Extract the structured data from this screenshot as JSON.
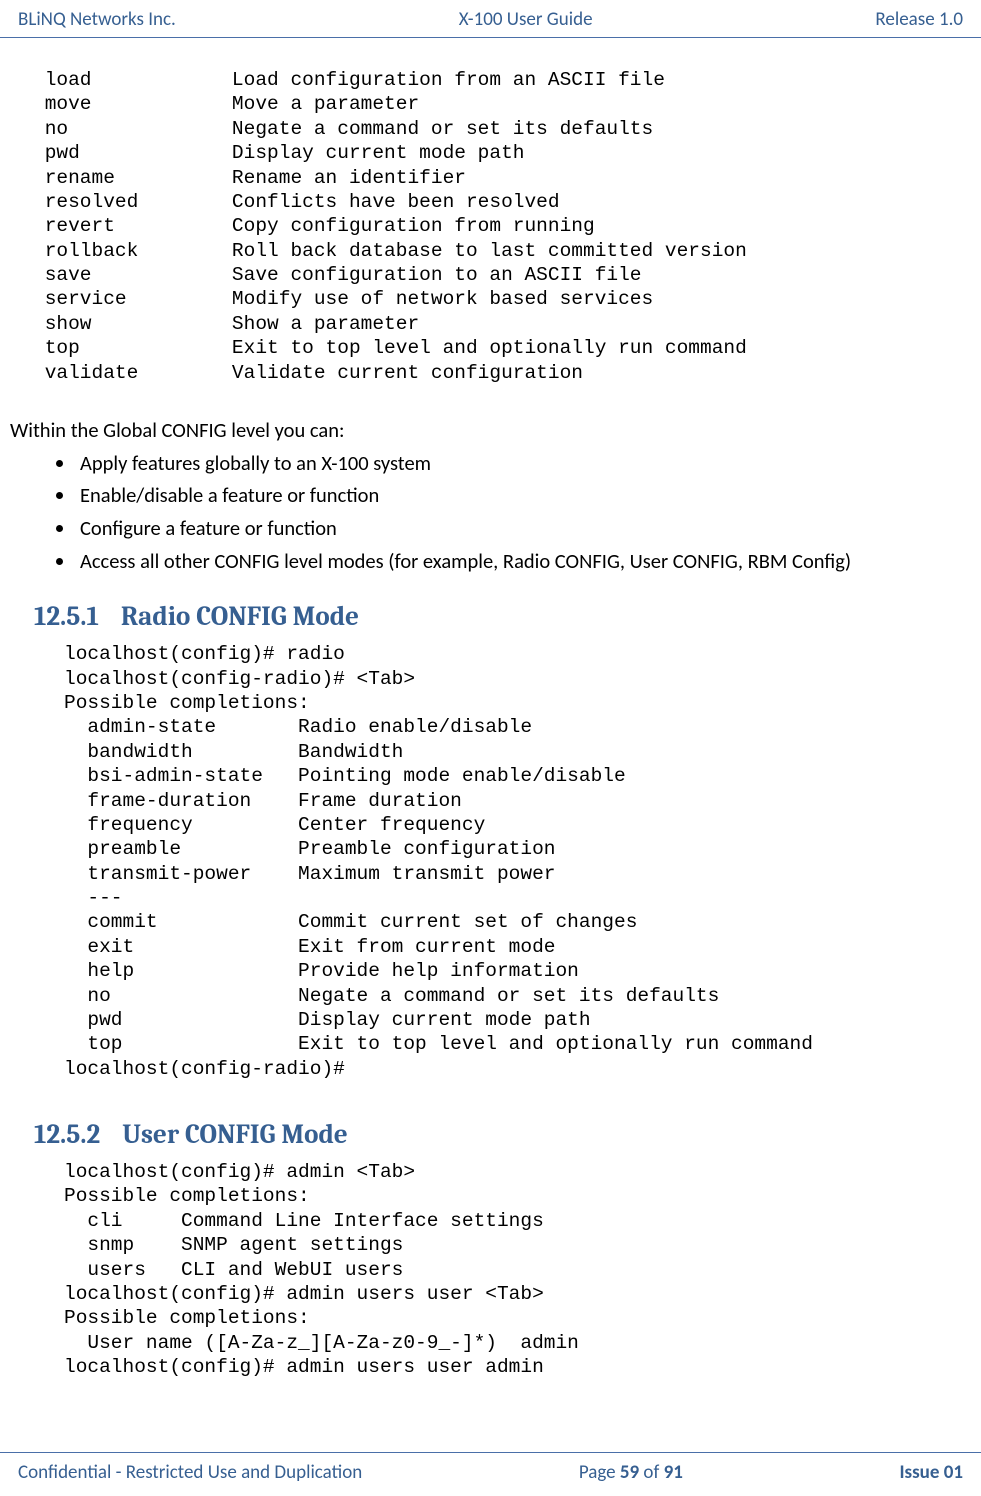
{
  "header": {
    "left": "BLiNQ Networks Inc.",
    "center": "X-100 User Guide",
    "right": "Release 1.0"
  },
  "footer": {
    "left": "Confidential - Restricted Use and Duplication",
    "center_prefix": "Page ",
    "center_page": "59",
    "center_of": " of ",
    "center_total": "91",
    "right": "Issue 01"
  },
  "block1": " load            Load configuration from an ASCII file\n move            Move a parameter\n no              Negate a command or set its defaults\n pwd             Display current mode path\n rename          Rename an identifier\n resolved        Conflicts have been resolved\n revert          Copy configuration from running\n rollback        Roll back database to last committed version\n save            Save configuration to an ASCII file\n service         Modify use of network based services\n show            Show a parameter\n top             Exit to top level and optionally run command\n validate        Validate current configuration",
  "intro": "Within the Global CONFIG level you can:",
  "bullets": [
    "Apply features globally to an X-100 system",
    "Enable/disable a feature or function",
    "Configure a feature or function",
    "Access all other CONFIG level modes (for example, Radio CONFIG, User CONFIG, RBM Config)"
  ],
  "section1": {
    "num": "12.5.1",
    "title": "Radio CONFIG Mode"
  },
  "block2": "localhost(config)# radio\nlocalhost(config-radio)# <Tab>\nPossible completions:\n  admin-state       Radio enable/disable\n  bandwidth         Bandwidth\n  bsi-admin-state   Pointing mode enable/disable\n  frame-duration    Frame duration\n  frequency         Center frequency\n  preamble          Preamble configuration\n  transmit-power    Maximum transmit power\n  ---\n  commit            Commit current set of changes\n  exit              Exit from current mode\n  help              Provide help information\n  no                Negate a command or set its defaults\n  pwd               Display current mode path\n  top               Exit to top level and optionally run command\nlocalhost(config-radio)#",
  "section2": {
    "num": "12.5.2",
    "title": "User CONFIG Mode"
  },
  "block3": "localhost(config)# admin <Tab>\nPossible completions:\n  cli     Command Line Interface settings\n  snmp    SNMP agent settings\n  users   CLI and WebUI users\nlocalhost(config)# admin users user <Tab>\nPossible completions:\n  User name ([A-Za-z_][A-Za-z0-9_-]*)  admin\nlocalhost(config)# admin users user admin"
}
